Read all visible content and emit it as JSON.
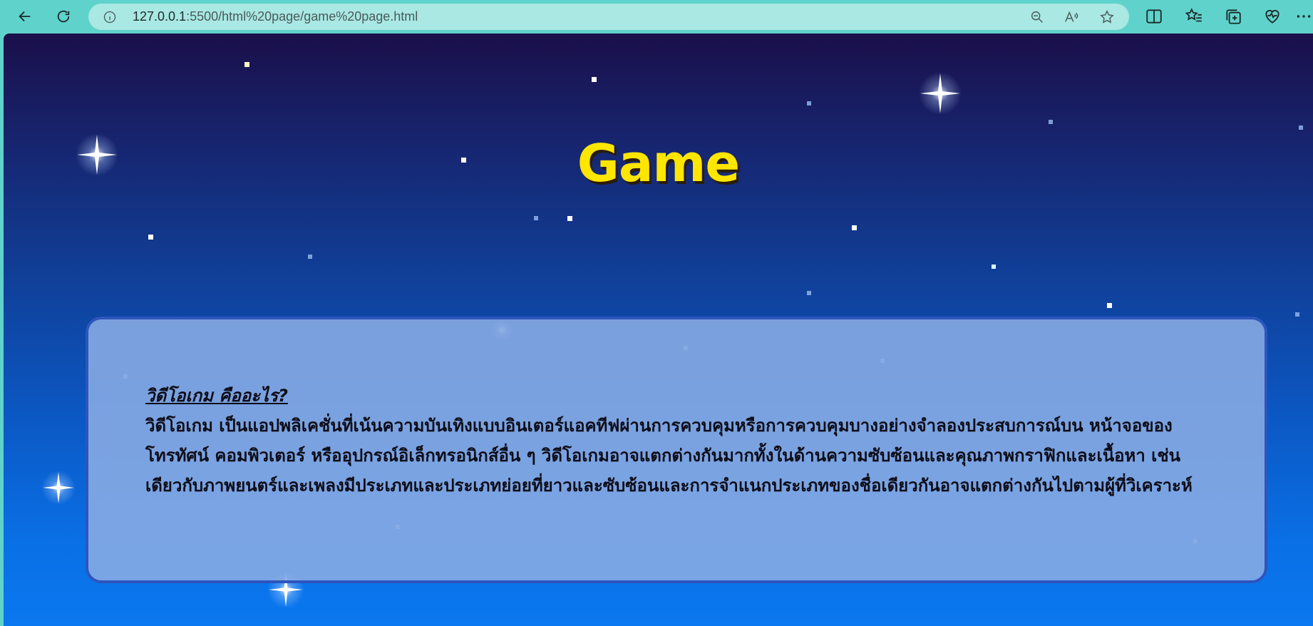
{
  "browser": {
    "url_host": "127.0.0.1",
    "url_rest": ":5500/html%20page/game%20page.html",
    "icons": {
      "back": "back-arrow-icon",
      "reload": "reload-icon",
      "info": "info-icon",
      "zoom": "zoom-out-icon",
      "read_aloud": "read-aloud-icon",
      "favorite": "star-icon",
      "split": "split-screen-icon",
      "favorites": "favorites-icon",
      "collections": "collections-icon",
      "health": "browser-essentials-icon",
      "more": "more-icon"
    }
  },
  "page": {
    "title": "Game",
    "heading": "วิดีโอเกม คืออะไร?",
    "body": "วิดีโอเกม เป็นแอปพลิเคชั่นที่เน้นความบันเทิงแบบอินเตอร์แอคทีฟผ่านการควบคุมหรือการควบคุมบางอย่างจำลองประสบการณ์บน หน้าจอของ โทรทัศน์ คอมพิวเตอร์ หรืออุปกรณ์อิเล็กทรอนิกส์อื่น ๆ วิดีโอเกมอาจแตกต่างกันมากทั้งในด้านความซับซ้อนและคุณภาพกราฟิกและเนื้อหา เช่นเดียวกับภาพยนตร์และเพลงมีประเภทและประเภทย่อยที่ยาวและซับซ้อนและการจำแนกประเภทของชื่อเดียวกันอาจแตกต่างกันไปตามผู้ที่วิเคราะห์",
    "colors": {
      "title": "#ffe600",
      "box_border": "#2d55bd",
      "box_fill": "#8aace4"
    }
  }
}
